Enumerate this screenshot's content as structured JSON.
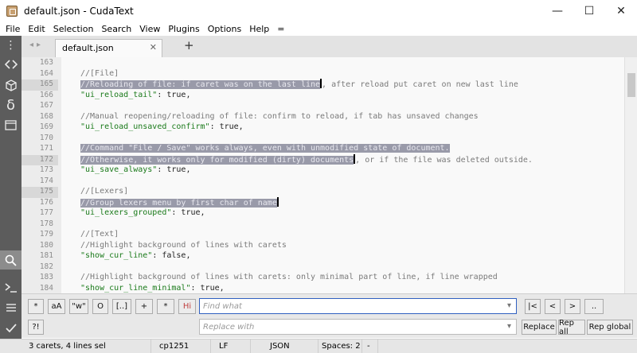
{
  "window": {
    "title": "default.json - CudaText",
    "controls": [
      "—",
      "☐",
      "✕"
    ]
  },
  "menu": [
    "File",
    "Edit",
    "Selection",
    "Search",
    "View",
    "Plugins",
    "Options",
    "Help",
    "="
  ],
  "sidebar": {
    "icons": [
      "dots-icon",
      "code-icon",
      "cube-icon",
      "delta-icon",
      "panel-icon",
      "search-icon",
      "terminal-icon",
      "list-icon",
      "check-icon"
    ]
  },
  "tabs": {
    "nav_arrows": "◂▸",
    "active_tab": "default.json",
    "close": "✕",
    "add": "+"
  },
  "editor": {
    "line_numbers": [
      "163",
      "164",
      "165",
      "166",
      "167",
      "168",
      "169",
      "170",
      "171",
      "172",
      "173",
      "174",
      "175",
      "176",
      "177",
      "178",
      "179",
      "180",
      "181",
      "182",
      "183",
      "184",
      "185"
    ],
    "active_line_numbers": [
      "165",
      "172",
      "175"
    ],
    "lines": {
      "l163": "",
      "l164": "//[File]",
      "l165_sel": "//Reloading of file: if caret was on the last line",
      "l165_rest": ", after reload put caret on new last line",
      "l166_key": "\"ui_reload_tail\"",
      "l166_rest": ": true,",
      "l167": "",
      "l168": "//Manual reopening/reloading of file: confirm to reload, if tab has unsaved changes",
      "l169_key": "\"ui_reload_unsaved_confirm\"",
      "l169_rest": ": true,",
      "l170": "",
      "l171_sel": "//Command \"File / Save\" works always, even with unmodified state of document.",
      "l172_sel": "//Otherwise, it works only for modified (dirty) documents",
      "l172_rest": ", or if the file was deleted outside.",
      "l173_key": "\"ui_save_always\"",
      "l173_rest": ": true,",
      "l174": "",
      "l175": "//[Lexers]",
      "l176_sel": "//Group lexers menu by first char of name",
      "l177_key": "\"ui_lexers_grouped\"",
      "l177_rest": ": true,",
      "l178": "",
      "l179": "//[Text]",
      "l180": "//Highlight background of lines with carets",
      "l181_key": "\"show_cur_line\"",
      "l181_rest": ": false,",
      "l182": "",
      "l183": "//Highlight background of lines with carets: only minimal part of line, if line wrapped",
      "l184_key": "\"show_cur_line_minimal\"",
      "l184_rest": ": true,",
      "l185": ""
    }
  },
  "findbar": {
    "row1_buttons": [
      "*",
      "aA",
      "\"w\"",
      "O",
      "[..]",
      "+",
      "*",
      "Hi"
    ],
    "row2_button": "?!",
    "find_placeholder": "Find what",
    "replace_placeholder": "Replace with",
    "nav_buttons": [
      "|<",
      "<",
      ">",
      ".."
    ],
    "replace_buttons": [
      "Replace",
      "Rep all",
      "Rep global"
    ]
  },
  "status": {
    "carets": "3 carets, 4 lines sel",
    "encoding": "cp1251",
    "line_ending": "LF",
    "lexer": "JSON",
    "indent": "Spaces: 2",
    "extra": "-"
  },
  "colors": {
    "sidebar_bg": "#5c5c5c",
    "selection": "#999aa9",
    "comment": "#7a7a7a",
    "string": "#1a7a1a"
  }
}
